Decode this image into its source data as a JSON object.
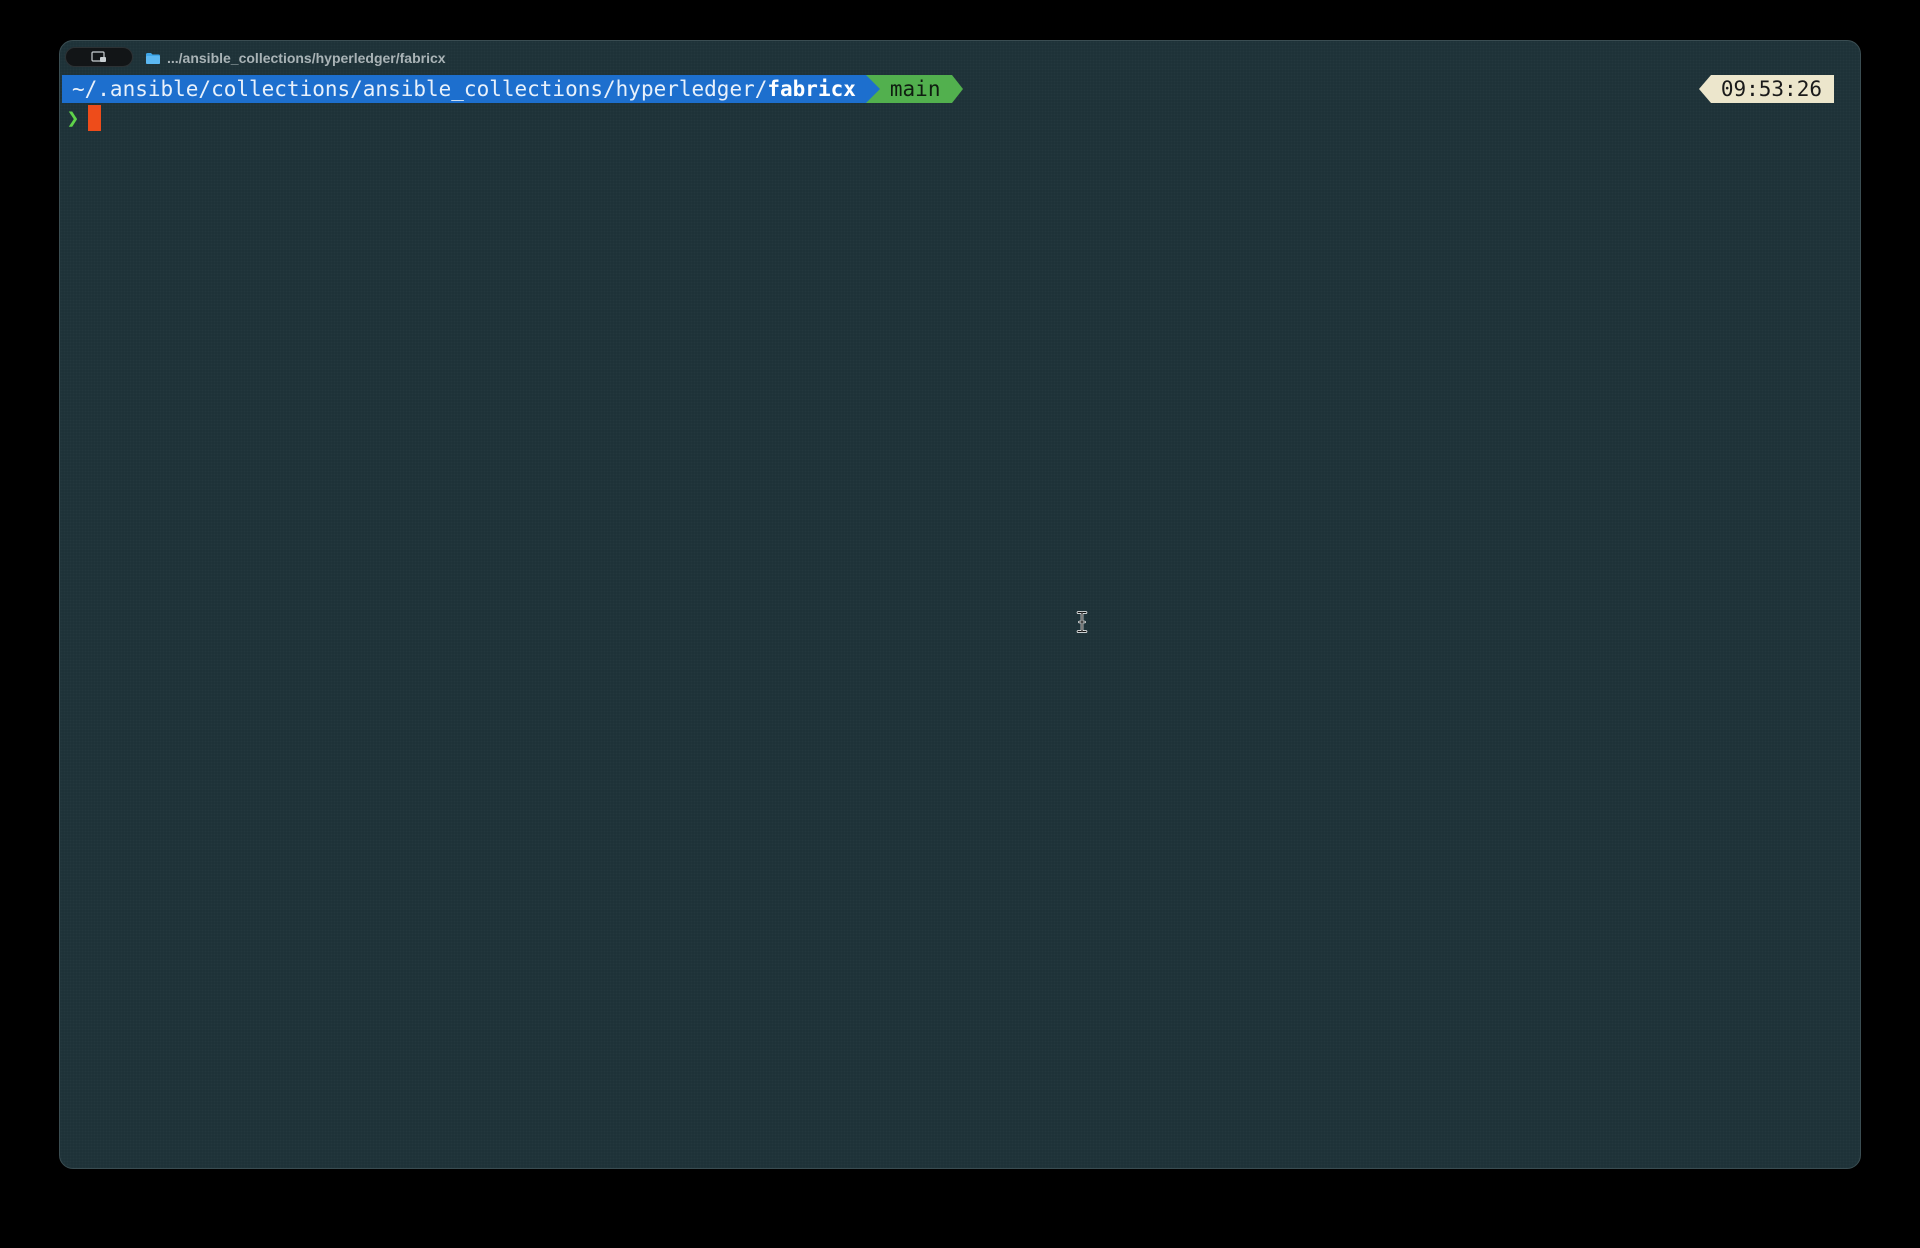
{
  "window": {
    "tab_title": ".../ansible_collections/hyperledger/fabricx",
    "tab_toggle_icon": "sidebar-toggle-icon",
    "folder_icon": "folder-icon",
    "colors": {
      "background": "#1e3238",
      "path_segment": "#1d6fce",
      "branch_segment": "#52b04e",
      "time_segment": "#ece6cc",
      "prompt_char": "#5fd34a",
      "cursor": "#ee4c1a"
    }
  },
  "prompt": {
    "path_prefix": "~/.ansible/collections/ansible_collections/hyperledger/",
    "path_current": "fabricx",
    "branch": "main",
    "time": "09:53:26",
    "prompt_char": "❯",
    "input": ""
  }
}
